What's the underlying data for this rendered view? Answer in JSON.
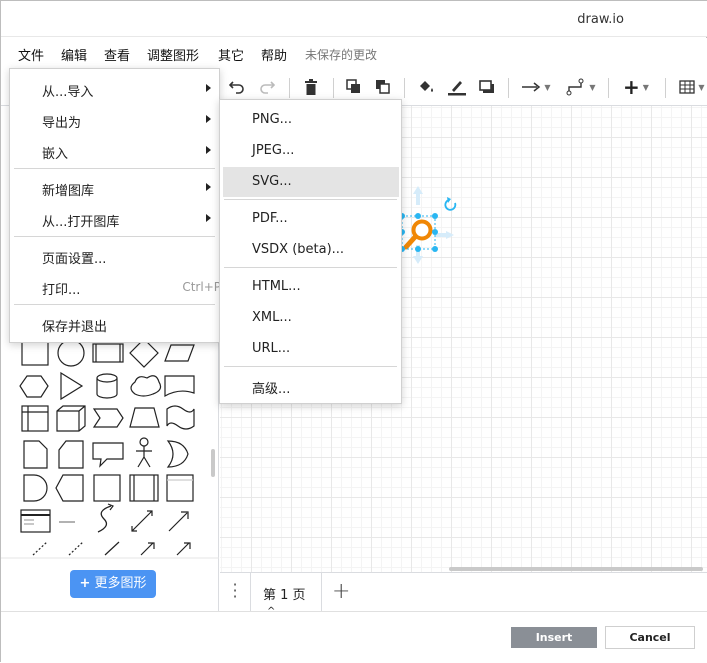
{
  "window": {
    "title": "draw.io"
  },
  "menubar": {
    "items": [
      "文件",
      "编辑",
      "查看",
      "调整图形",
      "其它",
      "帮助"
    ],
    "unsaved": "未保存的更改"
  },
  "file_menu": {
    "items": [
      {
        "label": "从...导入",
        "submenu": true
      },
      {
        "label": "导出为",
        "submenu": true
      },
      {
        "label": "嵌入",
        "submenu": true
      },
      {
        "label": "新增图库",
        "submenu": true
      },
      {
        "label": "从...打开图库",
        "submenu": true
      },
      {
        "label": "页面设置..."
      },
      {
        "label": "打印...",
        "shortcut": "Ctrl+P"
      },
      {
        "label": "保存并退出"
      }
    ]
  },
  "export_menu": {
    "items": [
      "PNG...",
      "JPEG...",
      "SVG...",
      "PDF...",
      "VSDX (beta)...",
      "HTML...",
      "XML...",
      "URL...",
      "高级..."
    ],
    "highlighted": "SVG..."
  },
  "sidebar": {
    "more_shapes": "更多图形"
  },
  "pagebar": {
    "tab_label": "第 1 页"
  },
  "footer": {
    "insert": "Insert",
    "cancel": "Cancel"
  },
  "colors": {
    "accent": "#4b94f3",
    "handles": "#29b6f2",
    "shape_orange": "#f08705"
  }
}
